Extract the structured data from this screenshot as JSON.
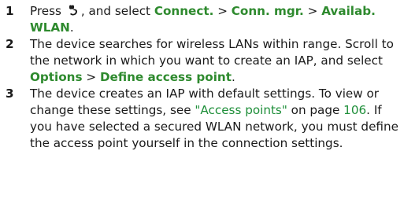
{
  "steps": [
    {
      "number": "1",
      "prefix": "Press",
      "icon": "menu-key-icon",
      "mid": ", and select",
      "path": [
        "Connect.",
        "Conn. mgr.",
        "Availab. WLAN"
      ],
      "separator": ">",
      "end": "."
    },
    {
      "number": "2",
      "text": "The device searches for wireless LANs within range. Scroll to the network in which you want to create an IAP, and select",
      "path": [
        "Options",
        "Define access point"
      ],
      "separator": ">",
      "end": "."
    },
    {
      "number": "3",
      "text_before_link": "The device creates an IAP with default settings. To view or change these settings, see",
      "link_text": "\"Access points\"",
      "text_on": "on page",
      "page_ref": "106",
      "text_after": ". If you have selected a secured WLAN network, you must define the access point yourself in the connection settings."
    }
  ],
  "colors": {
    "highlight": "#2e8a2e",
    "link": "#1f8f3a",
    "body_text": "#1a1a1a"
  }
}
